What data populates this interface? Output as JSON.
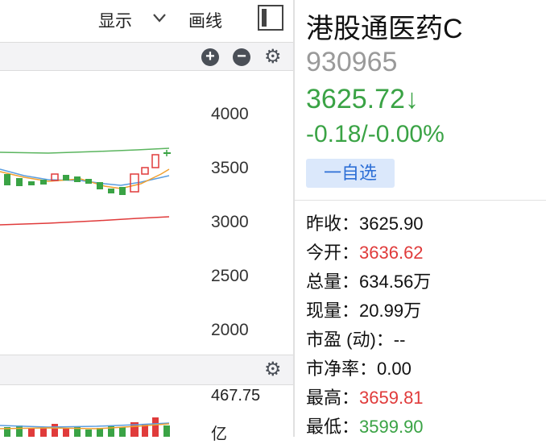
{
  "toolbar": {
    "show_label": "显示",
    "draw_label": "画线"
  },
  "kline": {
    "y_ticks": [
      "4000",
      "3500",
      "3000",
      "2500",
      "2000"
    ]
  },
  "volume": {
    "max_label": "467.75",
    "unit_label": "亿"
  },
  "stock": {
    "name": "港股通医药C",
    "code": "930965",
    "price": "3625.72↓",
    "change": "-0.18/-0.00%",
    "watch_button": "一自选"
  },
  "stats": [
    {
      "label": "昨收：",
      "value": "3625.90",
      "tone": "normal"
    },
    {
      "label": "今开：",
      "value": "3636.62",
      "tone": "red"
    },
    {
      "label": "总量：",
      "value": "634.56万",
      "tone": "normal"
    },
    {
      "label": "现量：",
      "value": "20.99万",
      "tone": "normal"
    },
    {
      "label": "市盈 (动)：",
      "value": "--",
      "tone": "normal"
    },
    {
      "label": "市净率：",
      "value": "0.00",
      "tone": "normal"
    },
    {
      "label": "最高：",
      "value": "3659.81",
      "tone": "red"
    },
    {
      "label": "最低：",
      "value": "3599.90",
      "tone": "green"
    }
  ],
  "colors": {
    "up": "#e03b3b",
    "down": "#3aa345",
    "accent": "#2d6fd6"
  },
  "icons": [
    "chevron-down-icon",
    "panel-toggle-icon",
    "zoom-in-icon",
    "zoom-out-icon",
    "gear-icon"
  ]
}
